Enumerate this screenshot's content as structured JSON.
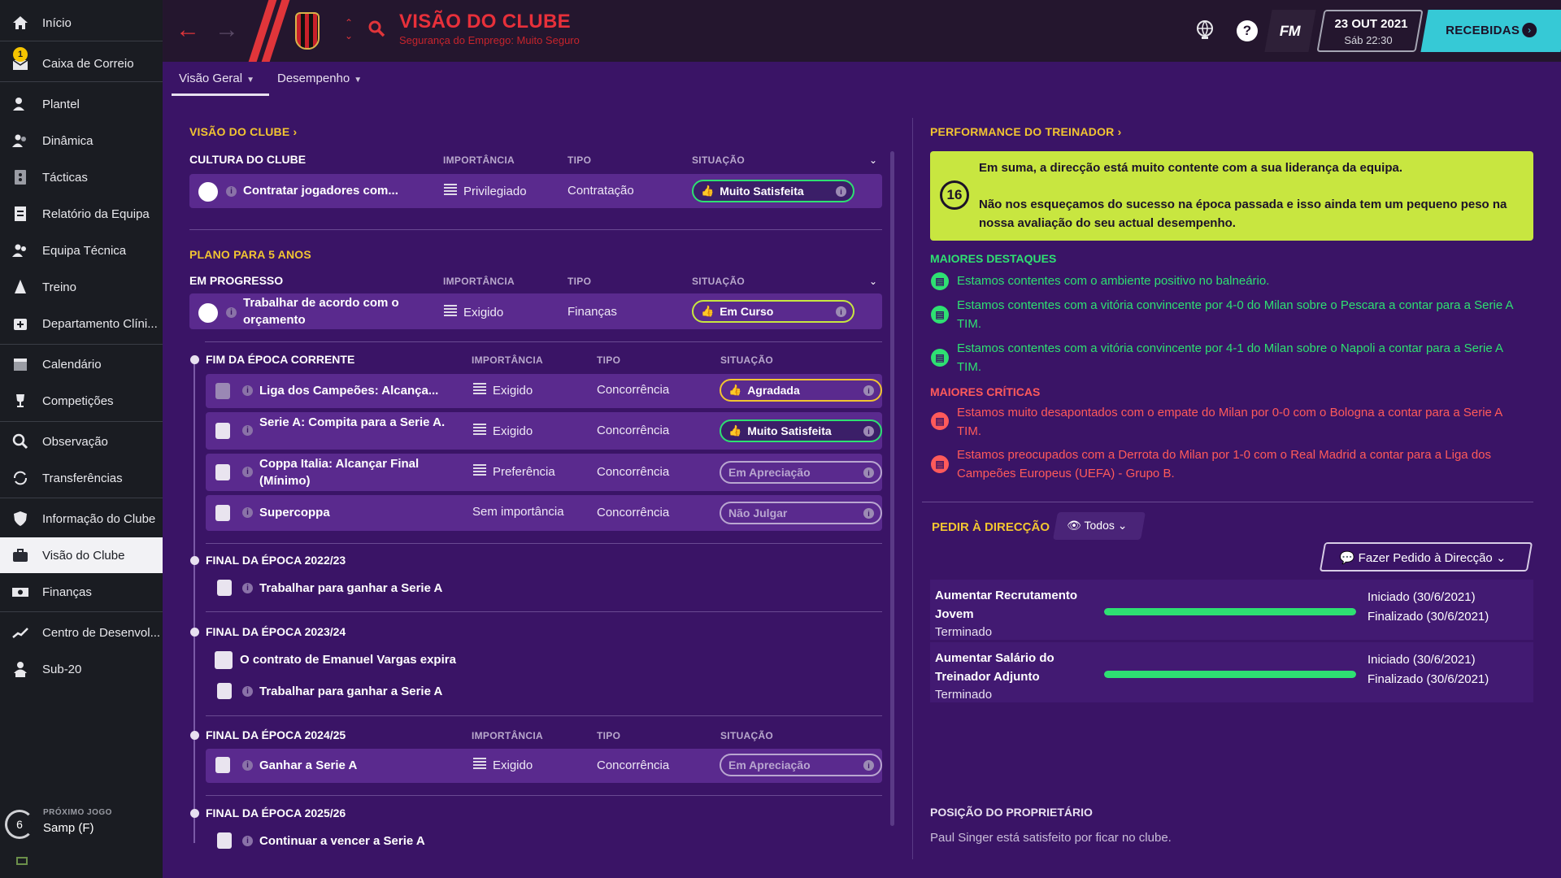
{
  "sidebar": {
    "items": [
      {
        "label": "Início"
      },
      {
        "label": "Caixa de Correio",
        "badge": "1"
      },
      {
        "label": "Plantel"
      },
      {
        "label": "Dinâmica"
      },
      {
        "label": "Tácticas"
      },
      {
        "label": "Relatório da Equipa"
      },
      {
        "label": "Equipa Técnica"
      },
      {
        "label": "Treino"
      },
      {
        "label": "Departamento Clíni..."
      },
      {
        "label": "Calendário"
      },
      {
        "label": "Competições"
      },
      {
        "label": "Observação"
      },
      {
        "label": "Transferências"
      },
      {
        "label": "Informação do Clube"
      },
      {
        "label": "Visão do Clube"
      },
      {
        "label": "Finanças"
      },
      {
        "label": "Centro de Desenvol..."
      },
      {
        "label": "Sub-20"
      }
    ],
    "next_game": {
      "label": "PRÓXIMO JOGO",
      "value": "Samp (F)",
      "days": "6"
    }
  },
  "header": {
    "title": "VISÃO DO CLUBE",
    "subtitle": "Segurança do Emprego: Muito Seguro",
    "fm": "FM",
    "date": "23 OUT 2021",
    "time": "Sáb 22:30",
    "inbox": "RECEBIDAS",
    "help": "?"
  },
  "tabs": [
    {
      "label": "Visão Geral"
    },
    {
      "label": "Desempenho"
    }
  ],
  "left": {
    "club_vision_link": "VISÃO DO CLUBE",
    "culture_hdr": "CULTURA DO CLUBE",
    "cols": {
      "importance": "IMPORTÂNCIA",
      "type": "TIPO",
      "status": "SITUAÇÃO"
    },
    "culture_row": {
      "text": "Contratar jogadores com...",
      "importance": "Privilegiado",
      "type": "Contratação",
      "status": "Muito Satisfeita"
    },
    "plan_hdr": "PLANO PARA 5 ANOS",
    "in_progress_hdr": "EM PROGRESSO",
    "progress_row": {
      "text": "Trabalhar de acordo com o orçamento",
      "importance": "Exigido",
      "type": "Finanças",
      "status": "Em Curso"
    },
    "current_season_hdr": "FIM DA ÉPOCA CORRENTE",
    "current_rows": [
      {
        "text": "Liga dos Campeões: Alcança...",
        "importance": "Exigido",
        "type": "Concorrência",
        "status": "Agradada"
      },
      {
        "text": "Serie A: Compita para a Serie A.",
        "importance": "Exigido",
        "type": "Concorrência",
        "status": "Muito Satisfeita"
      },
      {
        "text": "Coppa Italia: Alcançar Final (Mínimo)",
        "importance": "Preferência",
        "type": "Concorrência",
        "status": "Em Apreciação"
      },
      {
        "text": "Supercoppa",
        "importance": "Sem importância",
        "type": "Concorrência",
        "status": "Não Julgar"
      }
    ],
    "s2223_hdr": "FINAL DA ÉPOCA 2022/23",
    "s2223_row": "Trabalhar para ganhar a Serie A",
    "s2324_hdr": "FINAL DA ÉPOCA 2023/24",
    "s2324_rows": [
      "O contrato de Emanuel Vargas expira",
      "Trabalhar para ganhar a Serie A"
    ],
    "s2425_hdr": "FINAL DA ÉPOCA 2024/25",
    "s2425_row": {
      "text": "Ganhar a Serie A",
      "importance": "Exigido",
      "type": "Concorrência",
      "status": "Em Apreciação"
    },
    "s2526_hdr": "FINAL DA ÉPOCA 2025/26",
    "s2526_row": "Continuar a vencer a Serie A"
  },
  "right": {
    "perf_link": "PERFORMANCE DO TREINADOR",
    "perf_score": "16",
    "perf_p1": "Em suma, a direcção está muito contente com a sua liderança da equipa.",
    "perf_p2": "Não nos esqueçamos do sucesso na época passada e isso ainda tem um pequeno peso na nossa avaliação do seu actual desempenho.",
    "highlights_hdr": "MAIORES DESTAQUES",
    "highlights": [
      "Estamos contentes com o ambiente positivo no balneário.",
      "Estamos contentes com a vitória convincente por 4-0 do Milan sobre o Pescara a contar para a Serie A TIM.",
      "Estamos contentes com a vitória convincente por 4-1 do Milan sobre o Napoli a contar para a Serie A TIM."
    ],
    "critics_hdr": "MAIORES CRÍTICAS",
    "critics": [
      "Estamos muito desapontados com o empate do Milan por 0-0 com o Bologna a contar para a Serie A TIM.",
      "Estamos preocupados com a Derrota do Milan por 1-0 com o Real Madrid a contar para a Liga dos Campeões Europeus (UEFA) - Grupo B."
    ],
    "request_hdr": "PEDIR À DIRECÇÃO",
    "filter": "Todos",
    "request_btn": "Fazer Pedido à Direcção",
    "requests": [
      {
        "title": "Aumentar Recrutamento Jovem",
        "status": "Terminado",
        "started": "Iniciado (30/6/2021)",
        "finished": "Finalizado (30/6/2021)",
        "progress": 1.0
      },
      {
        "title": "Aumentar Salário do Treinador Adjunto",
        "status": "Terminado",
        "started": "Iniciado (30/6/2021)",
        "finished": "Finalizado (30/6/2021)",
        "progress": 1.0
      }
    ],
    "owner_hdr": "POSIÇÃO DO PROPRIETÁRIO",
    "owner_txt": "Paul Singer está satisfeito por ficar no clube."
  }
}
